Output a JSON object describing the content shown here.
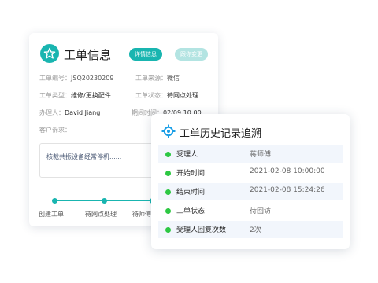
{
  "card": {
    "title": "工单信息",
    "detail_button": "详情信息",
    "change_button": "跟你变更",
    "fields": {
      "number_label": "工单编号：",
      "number_value": "JSQ20230209",
      "source_label": "工单来源：",
      "source_value": "微信",
      "type_label": "工单类型：",
      "type_value": "维修/更换配件",
      "status_label": "工单状态：",
      "status_value": "待网点处理",
      "handler_label": "办理人：",
      "handler_value": "David Jiang",
      "deadline_label": "期间时间：",
      "deadline_value": "02/09  10:00",
      "complaint_label": "客户诉求："
    },
    "complaint_text": "核裁共振设备经常停机......",
    "steps": [
      "创建工单",
      "待网点处理",
      "待师傅"
    ]
  },
  "history": {
    "title": "工单历史记录追溯",
    "rows": [
      {
        "key": "受理人",
        "value": "蒋师傅"
      },
      {
        "key": "开始时间",
        "value": "2021-02-08 10:00:00"
      },
      {
        "key": "结束时间",
        "value": "2021-02-08 15:24:26"
      },
      {
        "key": "工单状态",
        "value": "待回访"
      },
      {
        "key": "受理人回复次数",
        "value": "2次"
      }
    ]
  },
  "colors": {
    "accent": "#19b5b0",
    "accent_light": "#b3e4e2",
    "status_dot": "#2dc843",
    "history_icon": "#1a9ee6"
  }
}
